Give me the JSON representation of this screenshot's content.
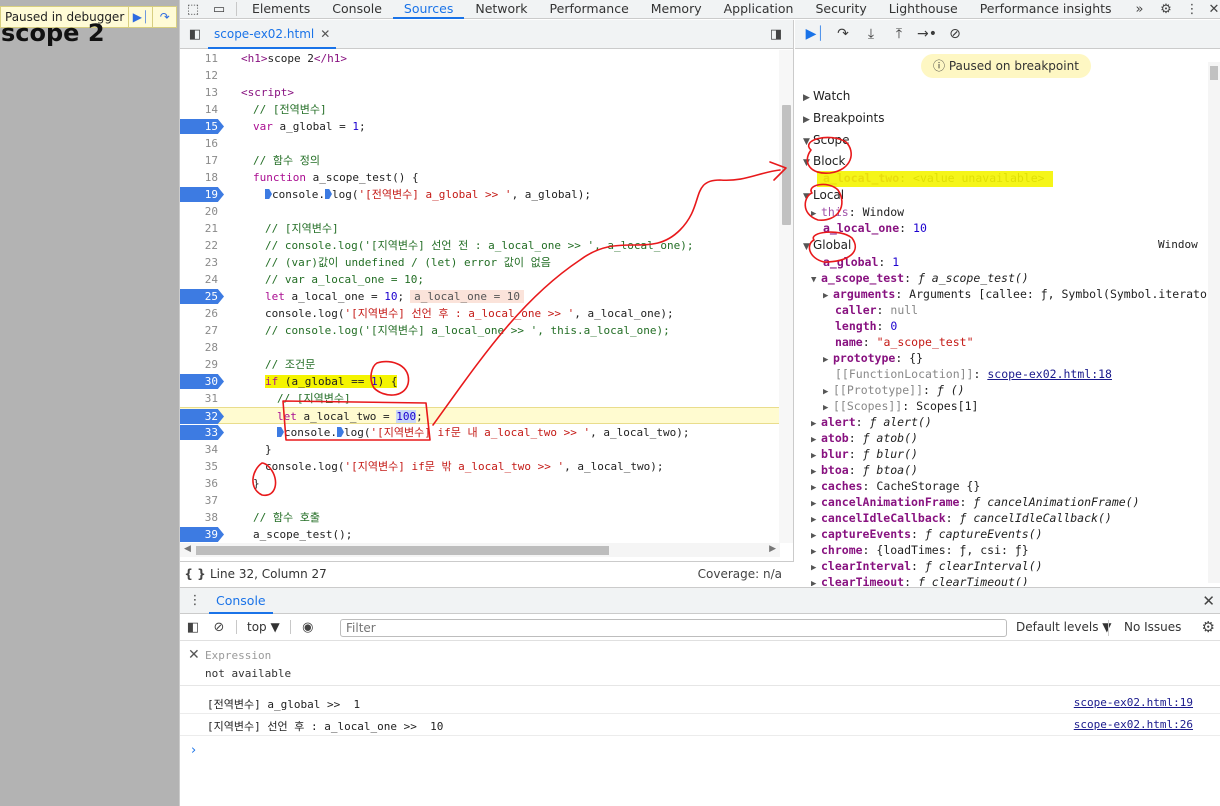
{
  "page": {
    "paused_label": "Paused in debugger",
    "heading": "scope 2"
  },
  "main_tabs": [
    "Elements",
    "Console",
    "Sources",
    "Network",
    "Performance",
    "Memory",
    "Application",
    "Security",
    "Lighthouse",
    "Performance insights"
  ],
  "active_main_tab": "Sources",
  "file_tab": {
    "name": "scope-ex02.html"
  },
  "code_lines": [
    {
      "n": "11",
      "bp": false,
      "html": "<span class='t-tag'>&lt;h1&gt;</span>scope 2<span class='t-tag'>&lt;/h1&gt;</span>",
      "indent": 0
    },
    {
      "n": "12",
      "bp": false,
      "html": "",
      "indent": 0
    },
    {
      "n": "13",
      "bp": false,
      "html": "<span class='t-tag'>&lt;script&gt;</span>",
      "indent": 0
    },
    {
      "n": "14",
      "bp": false,
      "html": "<span class='t-cmt'>// [전역변수]</span>",
      "indent": 1
    },
    {
      "n": "15",
      "bp": true,
      "html": "<span class='t-kw'>var</span> a_global = <span class='t-num'>1</span>;",
      "indent": 1
    },
    {
      "n": "16",
      "bp": false,
      "html": "",
      "indent": 0
    },
    {
      "n": "17",
      "bp": false,
      "html": "<span class='t-cmt'>// 함수 정의</span>",
      "indent": 1
    },
    {
      "n": "18",
      "bp": false,
      "html": "<span class='t-kw'>function</span> a_scope_test() {",
      "indent": 1
    },
    {
      "n": "19",
      "bp": true,
      "html": "<span class='bp-marker'></span>console.<span class='bp-marker'></span>log(<span class='t-str'>'[전역변수] a_global &gt;&gt; '</span>, a_global);",
      "indent": 2
    },
    {
      "n": "20",
      "bp": false,
      "html": "",
      "indent": 0
    },
    {
      "n": "21",
      "bp": false,
      "html": "<span class='t-cmt'>// [지역변수]</span>",
      "indent": 2
    },
    {
      "n": "22",
      "bp": false,
      "html": "<span class='t-cmt'>// console.log('[지역변수] 선언 전 : a_local_one &gt;&gt; ', a_local_one);</span>",
      "indent": 2
    },
    {
      "n": "23",
      "bp": false,
      "html": "<span class='t-cmt'>// (var)값이 undefined / (let) error 값이 없음</span>",
      "indent": 2
    },
    {
      "n": "24",
      "bp": false,
      "html": "<span class='t-cmt'>// var a_local_one = 10;</span>",
      "indent": 2
    },
    {
      "n": "25",
      "bp": true,
      "html": "<span class='t-kw'>let</span> a_local_one = <span class='t-num'>10</span>;<span class='inline-val'>a_local_one = 10</span>",
      "indent": 2
    },
    {
      "n": "26",
      "bp": false,
      "html": "console.log(<span class='t-str'>'[지역변수] 선언 후 : a_local_one &gt;&gt; '</span>, a_local_one);",
      "indent": 2
    },
    {
      "n": "27",
      "bp": false,
      "html": "<span class='t-cmt'>// console.log('[지역변수] a_local_one &gt;&gt; ', this.a_local_one);</span>",
      "indent": 2
    },
    {
      "n": "28",
      "bp": false,
      "html": "",
      "indent": 0
    },
    {
      "n": "29",
      "bp": false,
      "html": "<span class='t-cmt'>// 조건문</span>",
      "indent": 2
    },
    {
      "n": "30",
      "bp": true,
      "html": "<span class='hl-yellow'><span class='t-kw'>if</span> (a_global == <span class='t-num'>1</span>) {</span>",
      "indent": 2
    },
    {
      "n": "31",
      "bp": false,
      "html": "<span class='t-cmt'>// [지역변수]</span>",
      "indent": 3
    },
    {
      "n": "32",
      "bp": true,
      "cur": true,
      "html": "<span class='t-kw'>let</span> a_local_two = <span class='t-num' style='background:#c9d8f7'>100</span>;",
      "indent": 3
    },
    {
      "n": "33",
      "bp": true,
      "html": "<span class='bp-marker'></span>console.<span class='bp-marker'></span>log(<span class='t-str'>'[지역변수] if문 내 a_local_two &gt;&gt; '</span>, a_local_two);",
      "indent": 3
    },
    {
      "n": "34",
      "bp": false,
      "html": "}",
      "indent": 2
    },
    {
      "n": "35",
      "bp": false,
      "html": "console.log(<span class='t-str'>'[지역변수] if문 밖 a_local_two &gt;&gt; '</span>, a_local_two);",
      "indent": 2
    },
    {
      "n": "36",
      "bp": false,
      "html": "}",
      "indent": 1
    },
    {
      "n": "37",
      "bp": false,
      "html": "",
      "indent": 0
    },
    {
      "n": "38",
      "bp": false,
      "html": "<span class='t-cmt'>// 함수 호출</span>",
      "indent": 1
    },
    {
      "n": "39",
      "bp": true,
      "html": "a_scope_test();",
      "indent": 1
    }
  ],
  "status_bar": {
    "position": "Line 32, Column 27",
    "coverage": "Coverage: n/a"
  },
  "debugger": {
    "banner": "Paused on breakpoint",
    "sections": [
      "Watch",
      "Breakpoints",
      "Scope"
    ],
    "block_label": "Block",
    "block_var": {
      "name": "a_local_two",
      "value": "<value unavailable>"
    },
    "local_label": "Local",
    "local_vars": [
      {
        "name": "this",
        "value": "Window"
      },
      {
        "name": "a_local_one",
        "value": "10"
      }
    ],
    "global_label": "Global",
    "global_type": "Window",
    "global_vars": [
      {
        "name": "a_global",
        "value": "1",
        "kind": "num",
        "tri": "",
        "dim": false,
        "level": 1
      },
      {
        "name": "a_scope_test",
        "value": "ƒ a_scope_test()",
        "kind": "fn",
        "tri": "▼",
        "dim": false,
        "level": 1
      },
      {
        "name": "arguments",
        "value": "Arguments [callee: ƒ, Symbol(Symbol.iterator): ƒ]",
        "kind": "obj",
        "tri": "▶",
        "dim": false,
        "level": 2
      },
      {
        "name": "caller",
        "value": "null",
        "kind": "gray",
        "tri": "",
        "dim": false,
        "level": 2
      },
      {
        "name": "length",
        "value": "0",
        "kind": "num",
        "tri": "",
        "dim": false,
        "level": 2
      },
      {
        "name": "name",
        "value": "\"a_scope_test\"",
        "kind": "str",
        "tri": "",
        "dim": false,
        "level": 2
      },
      {
        "name": "prototype",
        "value": "{}",
        "kind": "obj",
        "tri": "▶",
        "dim": false,
        "level": 2
      },
      {
        "name": "[[FunctionLocation]]",
        "value": "scope-ex02.html:18",
        "kind": "link",
        "tri": "",
        "dim": true,
        "level": 2
      },
      {
        "name": "[[Prototype]]",
        "value": "ƒ ()",
        "kind": "fn",
        "tri": "▶",
        "dim": true,
        "level": 2
      },
      {
        "name": "[[Scopes]]",
        "value": "Scopes[1]",
        "kind": "obj",
        "tri": "▶",
        "dim": true,
        "level": 2
      },
      {
        "name": "alert",
        "value": "ƒ alert()",
        "kind": "fn",
        "tri": "▶",
        "dim": false,
        "level": 1
      },
      {
        "name": "atob",
        "value": "ƒ atob()",
        "kind": "fn",
        "tri": "▶",
        "dim": false,
        "level": 1
      },
      {
        "name": "blur",
        "value": "ƒ blur()",
        "kind": "fn",
        "tri": "▶",
        "dim": false,
        "level": 1
      },
      {
        "name": "btoa",
        "value": "ƒ btoa()",
        "kind": "fn",
        "tri": "▶",
        "dim": false,
        "level": 1
      },
      {
        "name": "caches",
        "value": "CacheStorage {}",
        "kind": "obj",
        "tri": "▶",
        "dim": false,
        "level": 1
      },
      {
        "name": "cancelAnimationFrame",
        "value": "ƒ cancelAnimationFrame()",
        "kind": "fn",
        "tri": "▶",
        "dim": false,
        "level": 1
      },
      {
        "name": "cancelIdleCallback",
        "value": "ƒ cancelIdleCallback()",
        "kind": "fn",
        "tri": "▶",
        "dim": false,
        "level": 1
      },
      {
        "name": "captureEvents",
        "value": "ƒ captureEvents()",
        "kind": "fn",
        "tri": "▶",
        "dim": false,
        "level": 1
      },
      {
        "name": "chrome",
        "value": "{loadTimes: ƒ, csi: ƒ}",
        "kind": "obj",
        "tri": "▶",
        "dim": false,
        "level": 1
      },
      {
        "name": "clearInterval",
        "value": "ƒ clearInterval()",
        "kind": "fn",
        "tri": "▶",
        "dim": false,
        "level": 1
      },
      {
        "name": "clearTimeout",
        "value": "ƒ clearTimeout()",
        "kind": "fn",
        "tri": "▶",
        "dim": false,
        "level": 1
      }
    ]
  },
  "console": {
    "tab": "Console",
    "context": "top",
    "filter_placeholder": "Filter",
    "levels": "Default levels",
    "issues": "No Issues",
    "expression_placeholder": "Expression",
    "expression_value": "not available",
    "logs": [
      {
        "msg": "[전역변수] a_global >>  1",
        "src": "scope-ex02.html:19"
      },
      {
        "msg": "[지역변수] 선언 후 : a_local_one >>  10",
        "src": "scope-ex02.html:26"
      }
    ]
  },
  "colors": {
    "accent": "#1a73e8",
    "breakpoint": "#3d7be2",
    "annotation_red": "#e8191b",
    "highlight_yellow": "#f4f400"
  }
}
